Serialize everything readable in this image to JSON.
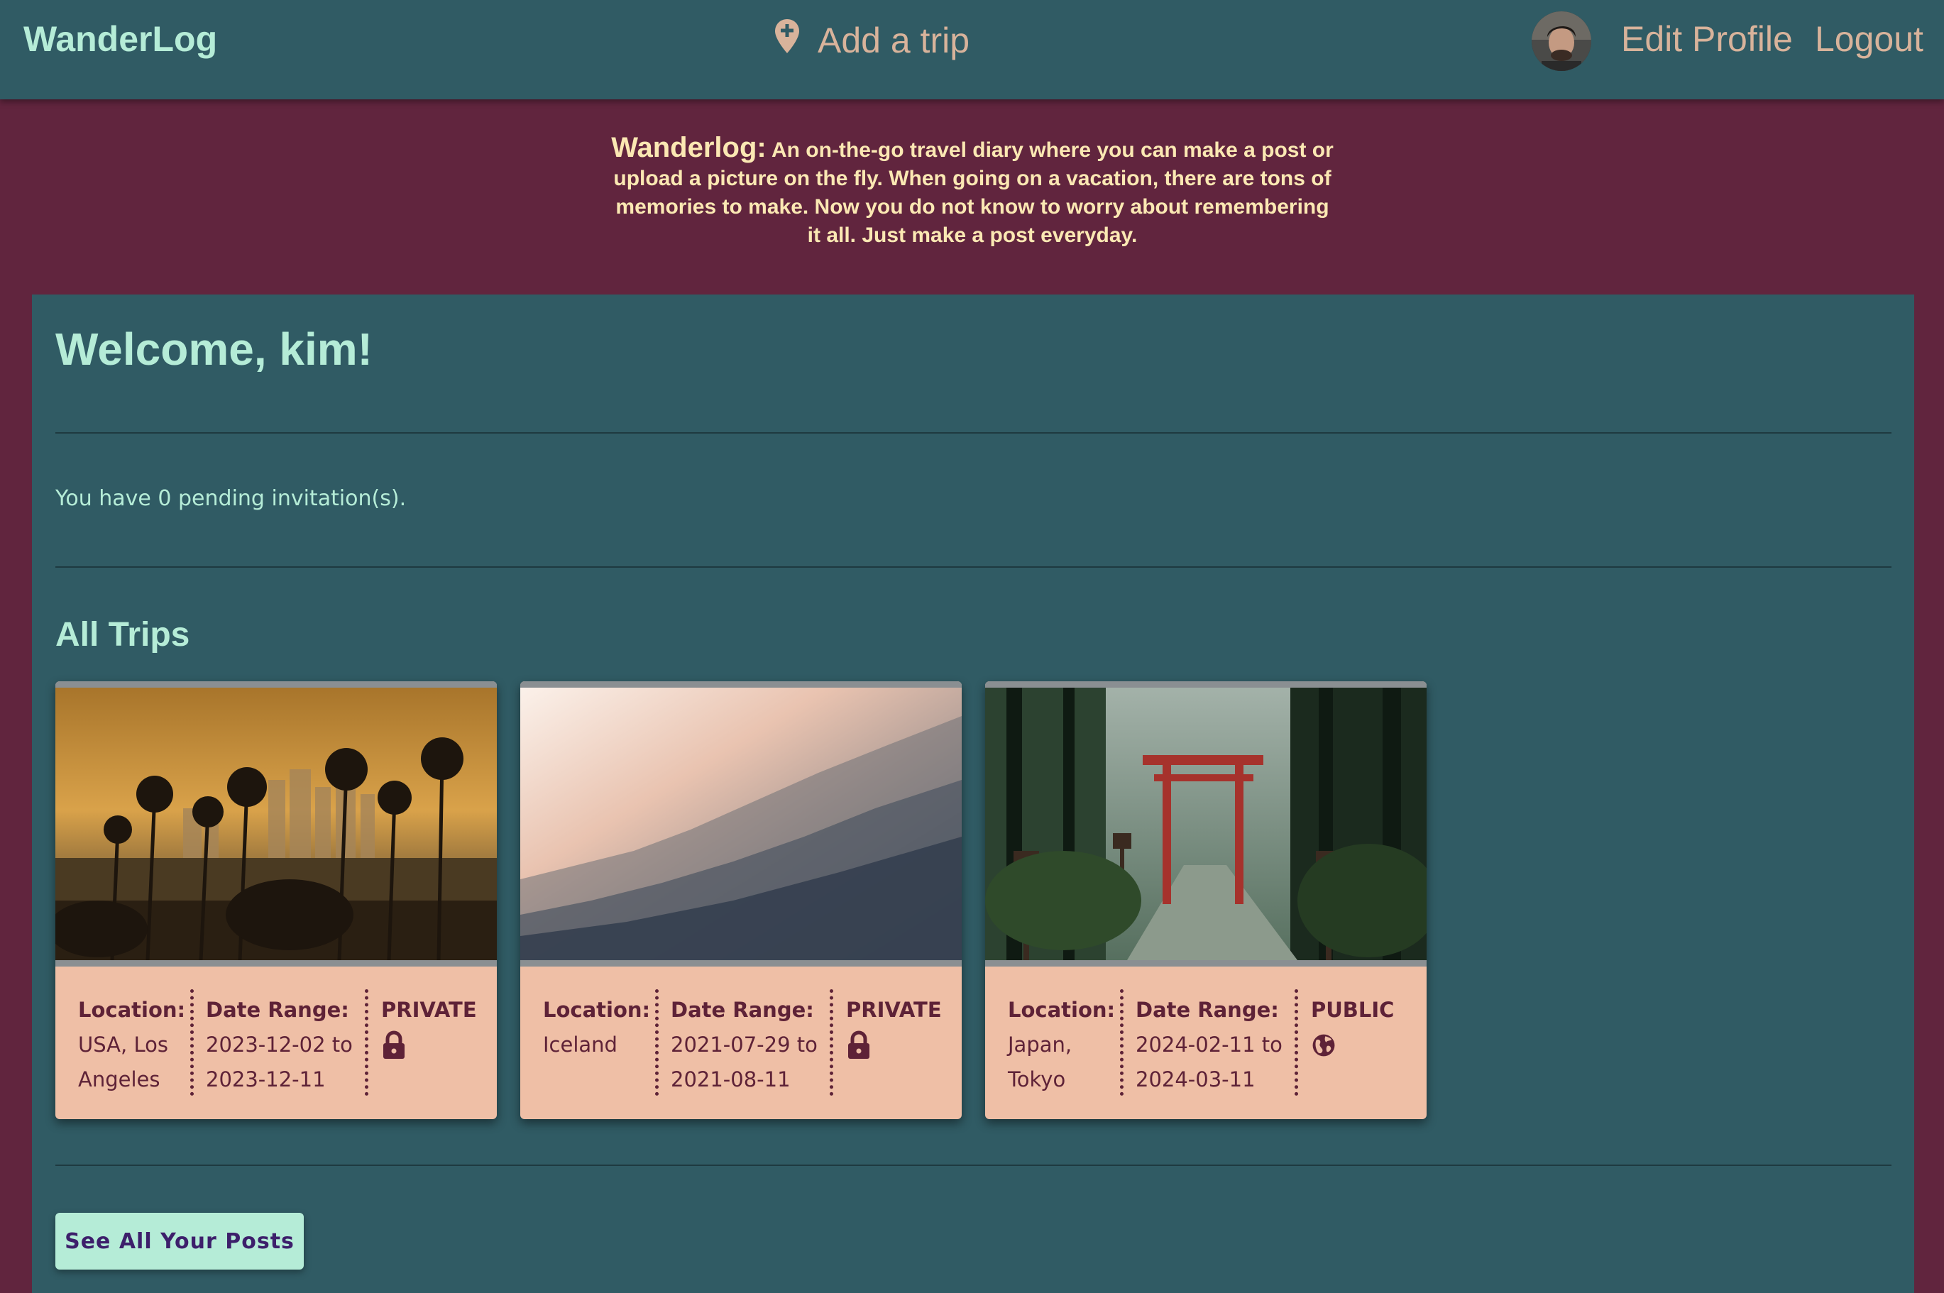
{
  "navbar": {
    "brand": "WanderLog",
    "add_trip_label": "Add a trip",
    "edit_profile_label": "Edit Profile",
    "logout_label": "Logout"
  },
  "hero": {
    "title": "Wanderlog:",
    "description": "An on-the-go travel diary where you can make a post or upload a picture on the fly. When going on a vacation, there are tons of memories to make. Now you do not know to worry about remembering it all. Just make a post everyday."
  },
  "main": {
    "welcome": "Welcome, kim!",
    "invitations_text": "You have 0 pending invitation(s).",
    "trips_heading": "All Trips",
    "trips": [
      {
        "location_label": "Location:",
        "location": "USA, Los Angeles",
        "date_label": "Date Range:",
        "date_range": "2023-12-02 to 2023-12-11",
        "visibility": "PRIVATE",
        "visibility_icon": "lock-icon"
      },
      {
        "location_label": "Location:",
        "location": "Iceland",
        "date_label": "Date Range:",
        "date_range": "2021-07-29 to 2021-08-11",
        "visibility": "PRIVATE",
        "visibility_icon": "lock-icon"
      },
      {
        "location_label": "Location:",
        "location": "Japan, Tokyo",
        "date_label": "Date Range:",
        "date_range": "2024-02-11 to 2024-03-11",
        "visibility": "PUBLIC",
        "visibility_icon": "globe-icon"
      }
    ],
    "see_all_posts_label": "See All Your Posts"
  },
  "colors": {
    "page_background": "#61253e",
    "navbar_background": "#305b64",
    "panel_background": "#305b64",
    "accent_mint": "#b5ecd7",
    "nav_link": "#d8b39b",
    "hero_text": "#fbe8b3",
    "card_background": "#efbfa6",
    "card_text": "#5e2237",
    "button_text": "#3d1f6b"
  }
}
